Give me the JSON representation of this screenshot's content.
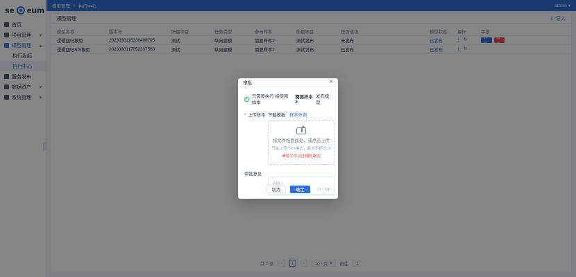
{
  "brand": {
    "logo_text_left": "se",
    "logo_text_right": "eum"
  },
  "sidebar": {
    "items": [
      {
        "label": "首页",
        "has_chevron": false,
        "active": false
      },
      {
        "label": "项目管理",
        "has_chevron": true,
        "active": false
      },
      {
        "label": "模型管理",
        "has_chevron": true,
        "active": true
      },
      {
        "label": "执行发起",
        "is_sub": true,
        "active": false
      },
      {
        "label": "执行中心",
        "is_sub": true,
        "active": true
      },
      {
        "label": "服务发布",
        "has_chevron": false,
        "active": false
      },
      {
        "label": "数据资产",
        "has_chevron": true,
        "active": false
      },
      {
        "label": "系统管理",
        "has_chevron": true,
        "active": false
      }
    ]
  },
  "topbar": {
    "breadcrumbs": [
      "模型管理",
      "执行中心"
    ],
    "user": "admin"
  },
  "panel": {
    "title": "模型管理",
    "export_label": "导入"
  },
  "table": {
    "headers": [
      "模型名称",
      "版本号",
      "所属项目",
      "任务类型",
      "参与样本",
      "所属项目",
      "是否成功",
      "",
      "模型状态",
      "操作",
      "审核"
    ],
    "rows": [
      {
        "cells": [
          "逻辑回归模型",
          "2023030116330498705",
          "测试",
          "纵向建模",
          "需要样本2",
          "测试发布",
          "未发布",
          "",
          "已发布",
          "",
          ""
        ],
        "status_link": "已发布",
        "actions": {
          "btn1": "详情",
          "btn2": "发布"
        }
      },
      {
        "cells": [
          "逻辑回归SPI模型",
          "2023030117052337560",
          "测试",
          "纵向建模",
          "需要样本2",
          "测试发布",
          "已发布",
          "",
          "已发布",
          "",
          ""
        ],
        "status_link": "已发布",
        "actions": {
          "btn1": "",
          "btn2": ""
        }
      }
    ]
  },
  "pagination": {
    "total": "共 2 条",
    "page": "1",
    "page_size": "10 / 页",
    "goto_label": "前往",
    "goto_value": "1"
  },
  "modal": {
    "title": "审批",
    "notice_prefix": "只需要执行 将使用样本",
    "notice_strong": "需要样本2",
    "notice_suffix": "发布模型",
    "upload_label": "上传样本",
    "upload_link_1": "下载模板",
    "upload_link_2": "样本示例",
    "upload_text": "将文件拖到此处，或点击上传",
    "upload_hint": "只能上传 TXT格式，最大不超过10",
    "upload_warn": "请将文件以压缩包格式",
    "comment_label": "审批意见",
    "comment_placeholder": "请输入",
    "comment_count": "0 / 100",
    "cancel": "取消",
    "confirm": "确定"
  },
  "colors": {
    "brand": "#2f6fd6",
    "danger": "#e24b4b"
  }
}
